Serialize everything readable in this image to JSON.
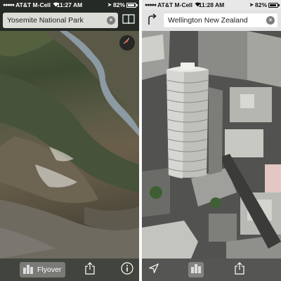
{
  "left": {
    "status": {
      "carrier": "AT&T M-Cell",
      "time": "11:27 AM",
      "battery": "82%",
      "battery_level": 0.82
    },
    "search": {
      "value": "Yosemite National Park",
      "clear_label": "×"
    },
    "toolbar": {
      "flyover_label": "Flyover"
    }
  },
  "right": {
    "status": {
      "carrier": "AT&T M-Cell",
      "time": "11:28 AM",
      "battery": "82%",
      "battery_level": 0.82
    },
    "search": {
      "value": "Wellington New Zealand",
      "clear_label": "×"
    }
  },
  "icons": {
    "signal": "signal-bars-icon",
    "wifi": "wifi-icon",
    "location_arrow": "location-arrow-icon",
    "bookmarks": "book-icon",
    "compass": "compass-icon",
    "directions": "directions-turn-icon",
    "buildings": "buildings-3d-icon",
    "share": "share-icon",
    "info": "info-icon"
  },
  "colors": {
    "terrain_dark": "#3e4a32",
    "river": "#8c9aa3",
    "compass_needle": "#e03b2f"
  }
}
